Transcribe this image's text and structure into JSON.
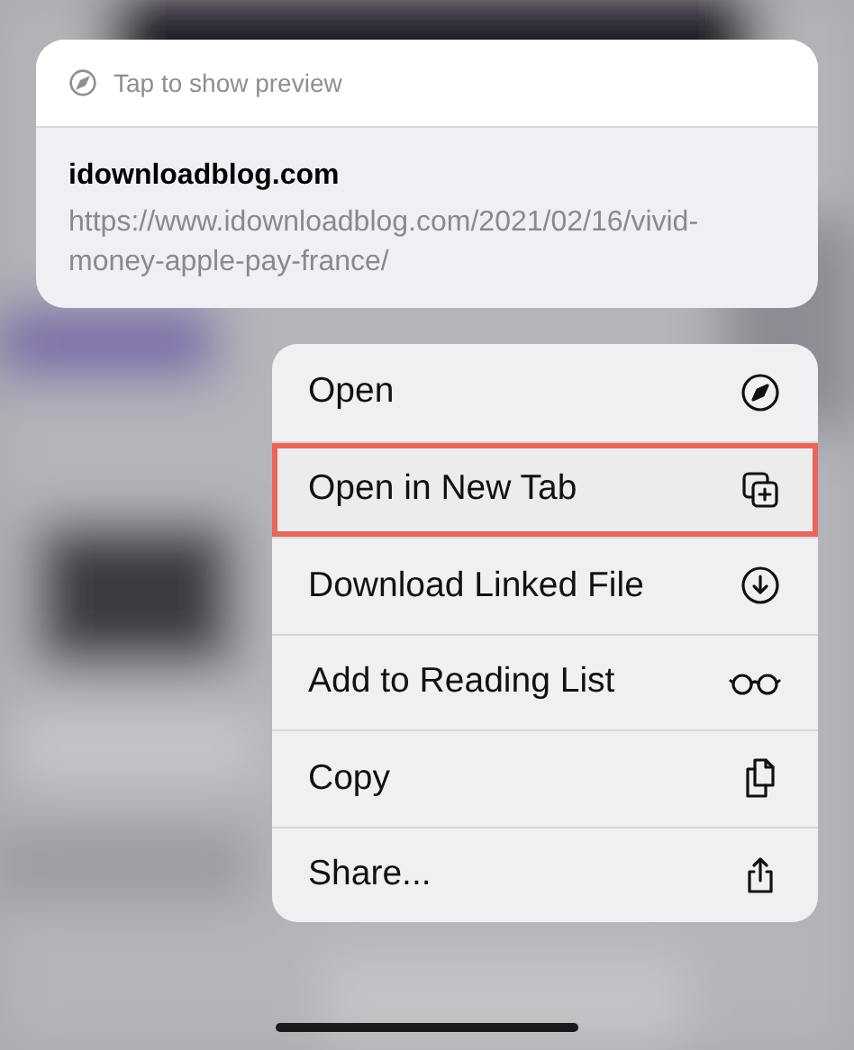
{
  "preview": {
    "hint": "Tap to show preview",
    "site": "idownloadblog.com",
    "url": "https://www.idownloadblog.com/2021/02/16/vivid-money-apple-pay-france/"
  },
  "menu": [
    {
      "label": "Open",
      "highlighted": false
    },
    {
      "label": "Open in New Tab",
      "highlighted": true
    },
    {
      "label": "Download Linked File",
      "highlighted": false
    },
    {
      "label": "Add to Reading List",
      "highlighted": false
    },
    {
      "label": "Copy",
      "highlighted": false
    },
    {
      "label": "Share...",
      "highlighted": false
    }
  ]
}
